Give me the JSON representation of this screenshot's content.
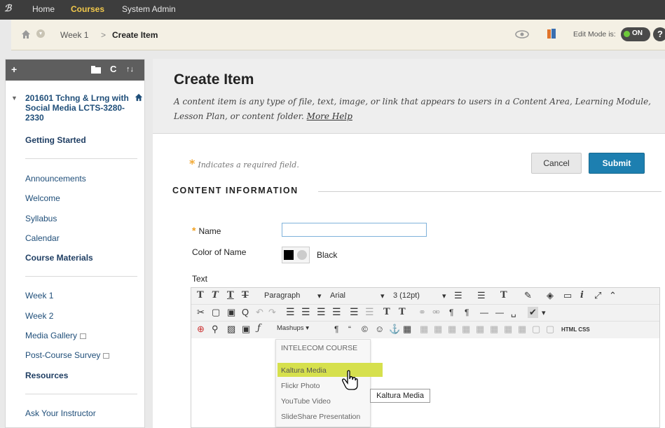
{
  "topnav": {
    "tabs": [
      {
        "label": "Home"
      },
      {
        "label": "Courses"
      },
      {
        "label": "System Admin"
      }
    ]
  },
  "breadcrumb": {
    "items": [
      "Week 1",
      "Create Item"
    ],
    "separator": ">",
    "edit_mode_label": "Edit Mode is:",
    "edit_mode_state": "ON",
    "help_label": "?"
  },
  "sidebar": {
    "tools": {
      "add": "+",
      "refresh": "C",
      "sort": "↑↓"
    },
    "course_name": "201601 Tchng & Lrng with Social Media LCTS-3280-2330",
    "items": [
      {
        "label": "Getting Started"
      },
      {
        "label": "Announcements"
      },
      {
        "label": "Welcome"
      },
      {
        "label": "Syllabus"
      },
      {
        "label": "Calendar"
      },
      {
        "label": "Course Materials"
      },
      {
        "label": "Week 1"
      },
      {
        "label": "Week 2"
      },
      {
        "label": "Media Gallery"
      },
      {
        "label": "Post-Course Survey"
      },
      {
        "label": "Resources"
      },
      {
        "label": "Ask Your Instructor"
      }
    ]
  },
  "main": {
    "title": "Create Item",
    "description": "A content item is any type of file, text, image, or link that appears to users in a Content Area, Learning Module, Lesson Plan, or content folder.",
    "more_help": "More Help",
    "required_note": "Indicates a required field.",
    "cancel_label": "Cancel",
    "submit_label": "Submit",
    "section_title": "CONTENT INFORMATION",
    "fields": {
      "name_label": "Name",
      "name_value": "",
      "color_label": "Color of Name",
      "color_value": "Black",
      "text_label": "Text"
    }
  },
  "editor": {
    "toolbar1": {
      "paragraph": "Paragraph",
      "font": "Arial",
      "size": "3 (12pt)"
    },
    "toolbar3": {
      "mashups": "Mashups",
      "html_css": "HTML CSS"
    },
    "mashups_menu": [
      {
        "label": "INTELECOM COURSE"
      },
      {
        "label": "Kaltura Media"
      },
      {
        "label": "Flickr Photo"
      },
      {
        "label": "YouTube Video"
      },
      {
        "label": "SlideShare Presentation"
      }
    ],
    "tooltip": "Kaltura Media"
  },
  "colors": {
    "accent": "#1d7fb0",
    "nav_active": "#f1c84b",
    "required_star": "#f0a020",
    "highlight": "#d6e04d",
    "edit_on": "#6ec93a"
  }
}
